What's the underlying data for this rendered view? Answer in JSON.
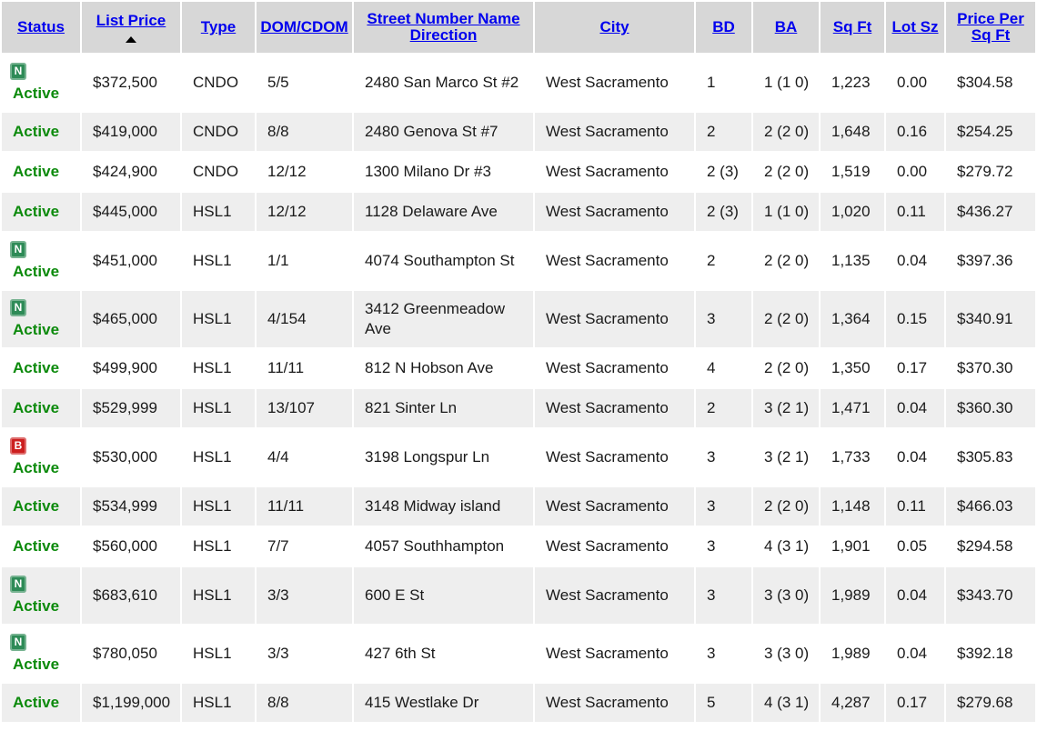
{
  "table": {
    "headers": {
      "status": "Status",
      "list_price": "List Price",
      "type": "Type",
      "dom": "DOM/CDOM",
      "street": "Street Number Name Direction",
      "city": "City",
      "bd": "BD",
      "ba": "BA",
      "sqft": "Sq Ft",
      "lot": "Lot Sz",
      "ppsf": "Price Per Sq Ft"
    },
    "sort": {
      "column": "List Price",
      "direction": "ascending"
    },
    "rows": [
      {
        "badge": "N",
        "status": "Active",
        "price": "$372,500",
        "type": "CNDO",
        "dom": "5/5",
        "street": "2480 San Marco St #2",
        "city": "West Sacramento",
        "bd": "1",
        "ba": "1 (1 0)",
        "sqft": "1,223",
        "lot": "0.00",
        "ppsf": "$304.58"
      },
      {
        "badge": "",
        "status": "Active",
        "price": "$419,000",
        "type": "CNDO",
        "dom": "8/8",
        "street": "2480 Genova St #7",
        "city": "West Sacramento",
        "bd": "2",
        "ba": "2 (2 0)",
        "sqft": "1,648",
        "lot": "0.16",
        "ppsf": "$254.25"
      },
      {
        "badge": "",
        "status": "Active",
        "price": "$424,900",
        "type": "CNDO",
        "dom": "12/12",
        "street": "1300 Milano Dr #3",
        "city": "West Sacramento",
        "bd": "2 (3)",
        "ba": "2 (2 0)",
        "sqft": "1,519",
        "lot": "0.00",
        "ppsf": "$279.72"
      },
      {
        "badge": "",
        "status": "Active",
        "price": "$445,000",
        "type": "HSL1",
        "dom": "12/12",
        "street": "1128 Delaware Ave",
        "city": "West Sacramento",
        "bd": "2 (3)",
        "ba": "1 (1 0)",
        "sqft": "1,020",
        "lot": "0.11",
        "ppsf": "$436.27"
      },
      {
        "badge": "N",
        "status": "Active",
        "price": "$451,000",
        "type": "HSL1",
        "dom": "1/1",
        "street": "4074 Southampton St",
        "city": "West Sacramento",
        "bd": "2",
        "ba": "2 (2 0)",
        "sqft": "1,135",
        "lot": "0.04",
        "ppsf": "$397.36"
      },
      {
        "badge": "N",
        "status": "Active",
        "price": "$465,000",
        "type": "HSL1",
        "dom": "4/154",
        "street": "3412 Greenmeadow Ave",
        "city": "West Sacramento",
        "bd": "3",
        "ba": "2 (2 0)",
        "sqft": "1,364",
        "lot": "0.15",
        "ppsf": "$340.91"
      },
      {
        "badge": "",
        "status": "Active",
        "price": "$499,900",
        "type": "HSL1",
        "dom": "11/11",
        "street": "812 N Hobson Ave",
        "city": "West Sacramento",
        "bd": "4",
        "ba": "2 (2 0)",
        "sqft": "1,350",
        "lot": "0.17",
        "ppsf": "$370.30"
      },
      {
        "badge": "",
        "status": "Active",
        "price": "$529,999",
        "type": "HSL1",
        "dom": "13/107",
        "street": "821 Sinter Ln",
        "city": "West Sacramento",
        "bd": "2",
        "ba": "3 (2 1)",
        "sqft": "1,471",
        "lot": "0.04",
        "ppsf": "$360.30"
      },
      {
        "badge": "B",
        "status": "Active",
        "price": "$530,000",
        "type": "HSL1",
        "dom": "4/4",
        "street": "3198 Longspur Ln",
        "city": "West Sacramento",
        "bd": "3",
        "ba": "3 (2 1)",
        "sqft": "1,733",
        "lot": "0.04",
        "ppsf": "$305.83"
      },
      {
        "badge": "",
        "status": "Active",
        "price": "$534,999",
        "type": "HSL1",
        "dom": "11/11",
        "street": "3148 Midway island",
        "city": "West Sacramento",
        "bd": "3",
        "ba": "2 (2 0)",
        "sqft": "1,148",
        "lot": "0.11",
        "ppsf": "$466.03"
      },
      {
        "badge": "",
        "status": "Active",
        "price": "$560,000",
        "type": "HSL1",
        "dom": "7/7",
        "street": "4057 Southhampton",
        "city": "West Sacramento",
        "bd": "3",
        "ba": "4 (3 1)",
        "sqft": "1,901",
        "lot": "0.05",
        "ppsf": "$294.58"
      },
      {
        "badge": "N",
        "status": "Active",
        "price": "$683,610",
        "type": "HSL1",
        "dom": "3/3",
        "street": "600 E St",
        "city": "West Sacramento",
        "bd": "3",
        "ba": "3 (3 0)",
        "sqft": "1,989",
        "lot": "0.04",
        "ppsf": "$343.70"
      },
      {
        "badge": "N",
        "status": "Active",
        "price": "$780,050",
        "type": "HSL1",
        "dom": "3/3",
        "street": "427 6th St",
        "city": "West Sacramento",
        "bd": "3",
        "ba": "3 (3 0)",
        "sqft": "1,989",
        "lot": "0.04",
        "ppsf": "$392.18"
      },
      {
        "badge": "",
        "status": "Active",
        "price": "$1,199,000",
        "type": "HSL1",
        "dom": "8/8",
        "street": "415 Westlake Dr",
        "city": "West Sacramento",
        "bd": "5",
        "ba": "4 (3 1)",
        "sqft": "4,287",
        "lot": "0.17",
        "ppsf": "$279.68"
      }
    ]
  }
}
